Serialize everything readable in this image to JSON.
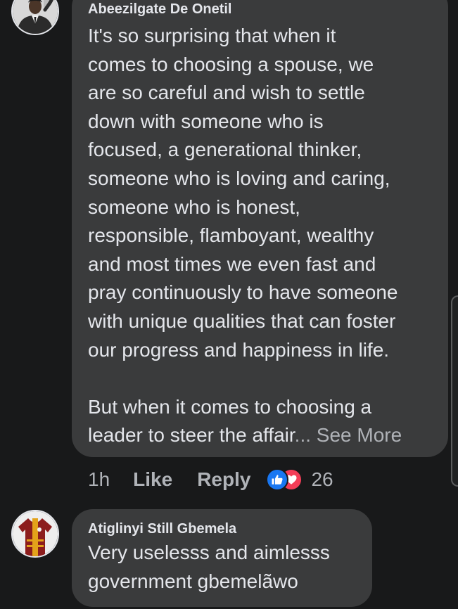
{
  "comments": [
    {
      "author": "Abeezilgate De Onetil",
      "avatar_icon": "person-avatar-icon",
      "text": "It's so surprising that when it\ncomes to choosing a spouse, we\nare so careful and wish to settle\ndown with someone who is\nfocused, a generational thinker,\nsomeone who is loving and caring,\nsomeone who is honest,\nresponsible, flamboyant, wealthy\nand most times we even fast and\npray continuously to have someone\nwith unique qualities that can foster\nour progress and happiness in life.\n\nBut when it comes to choosing a\nleader to steer the affair",
      "see_more": "... See More",
      "time": "1h",
      "like_label": "Like",
      "reply_label": "Reply",
      "reaction_icons": [
        "like-reaction-icon",
        "love-reaction-icon"
      ],
      "reaction_count": "26"
    },
    {
      "author": "Atiglinyi Still Gbemela",
      "avatar_icon": "jersey-avatar-icon",
      "text": "Very uselesss and aimlesss\ngovernment gbemelãwo"
    }
  ],
  "colors": {
    "background": "#18191a",
    "bubble": "#3a3b3c",
    "text": "#e4e6eb",
    "secondary_text": "#b0b3b8",
    "like_blue": "#1877f2",
    "love_red": "#f33e58"
  }
}
